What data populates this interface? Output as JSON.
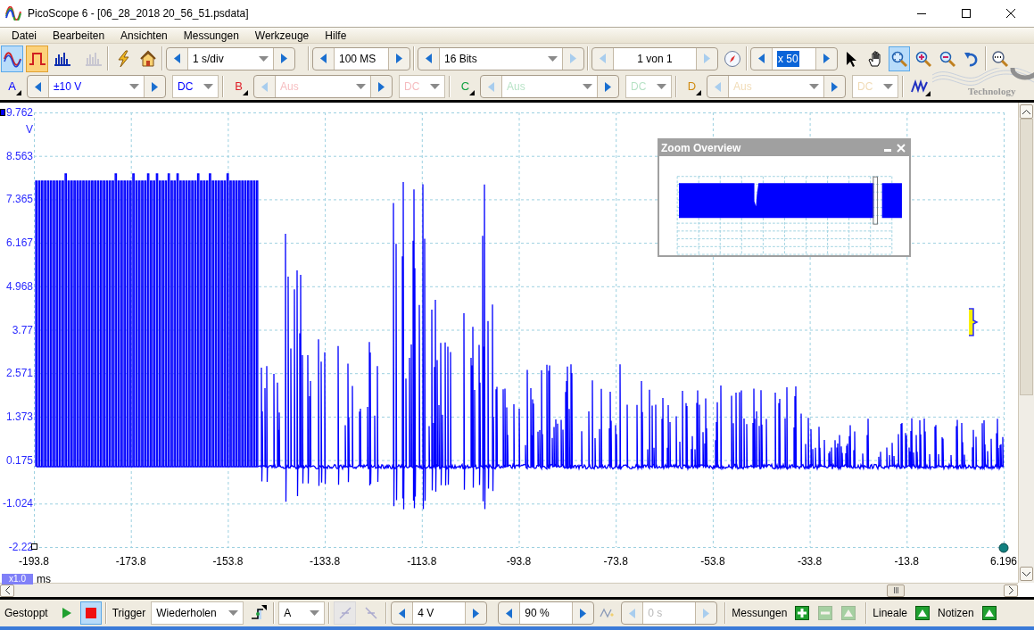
{
  "window": {
    "title": "PicoScope 6 - [06_28_2018 20_56_51.psdata]"
  },
  "menu": [
    "Datei",
    "Bearbeiten",
    "Ansichten",
    "Messungen",
    "Werkzeuge",
    "Hilfe"
  ],
  "view_modes": [
    {
      "kind": "scope",
      "selected": true,
      "disabled": false
    },
    {
      "kind": "persistence",
      "selected": true,
      "disabled": false
    },
    {
      "kind": "spectrum",
      "selected": false,
      "disabled": false
    },
    {
      "kind": "spectrum_persistence",
      "selected": false,
      "disabled": true
    }
  ],
  "timebase": "1 s/div",
  "samples": "100 MS",
  "resolution": "16 Bits",
  "buffer": "1 von 1",
  "zoom_factor": "x 50",
  "tools": [
    {
      "kind": "pointer",
      "selected": false
    },
    {
      "kind": "hand",
      "selected": false
    },
    {
      "kind": "zoom_box",
      "selected": true
    },
    {
      "kind": "zoom_in",
      "selected": false
    },
    {
      "kind": "zoom_out",
      "selected": false
    },
    {
      "kind": "undo_zoom",
      "selected": false
    },
    {
      "kind": "zoom_full",
      "selected": false
    }
  ],
  "channels": [
    {
      "label": "A",
      "color": "#0000ff",
      "range": "±10 V",
      "coupling": "DC",
      "enabled": true
    },
    {
      "label": "B",
      "color": "#e0202a",
      "range": "Aus",
      "coupling": "DC",
      "enabled": false
    },
    {
      "label": "C",
      "color": "#10a040",
      "range": "Aus",
      "coupling": "DC",
      "enabled": false
    },
    {
      "label": "D",
      "color": "#d08a10",
      "range": "Aus",
      "coupling": "DC",
      "enabled": false
    }
  ],
  "logo": {
    "text": "Technology"
  },
  "graph": {
    "y_unit": "V",
    "y_ticks": [
      "9.762",
      "8.563",
      "7.365",
      "6.167",
      "4.968",
      "3.77",
      "2.571",
      "1.373",
      "0.175",
      "-1.024",
      "-2.22"
    ],
    "x_ticks": [
      "-193.8",
      "-173.8",
      "-153.8",
      "-133.8",
      "-113.8",
      "-93.8",
      "-73.8",
      "-53.8",
      "-33.8",
      "-13.8",
      "6.196"
    ],
    "x_unit": "ms",
    "x_scale": "x1.0"
  },
  "zoom_overview": {
    "title": "Zoom Overview"
  },
  "status_bar": {
    "state": "Gestoppt",
    "running": false,
    "trigger_label": "Trigger",
    "trigger_mode": "Wiederholen",
    "trigger_source": "A",
    "threshold": "4 V",
    "pretrigger": "90 %",
    "delay": "0 s",
    "delay_enabled": false,
    "measurements_label": "Messungen",
    "measurement_buttons": [
      {
        "kind": "add",
        "disabled": false
      },
      {
        "kind": "remove",
        "disabled": true
      },
      {
        "kind": "expand",
        "disabled": true
      }
    ],
    "rulers_label": "Lineale",
    "notes_label": "Notizen"
  }
}
